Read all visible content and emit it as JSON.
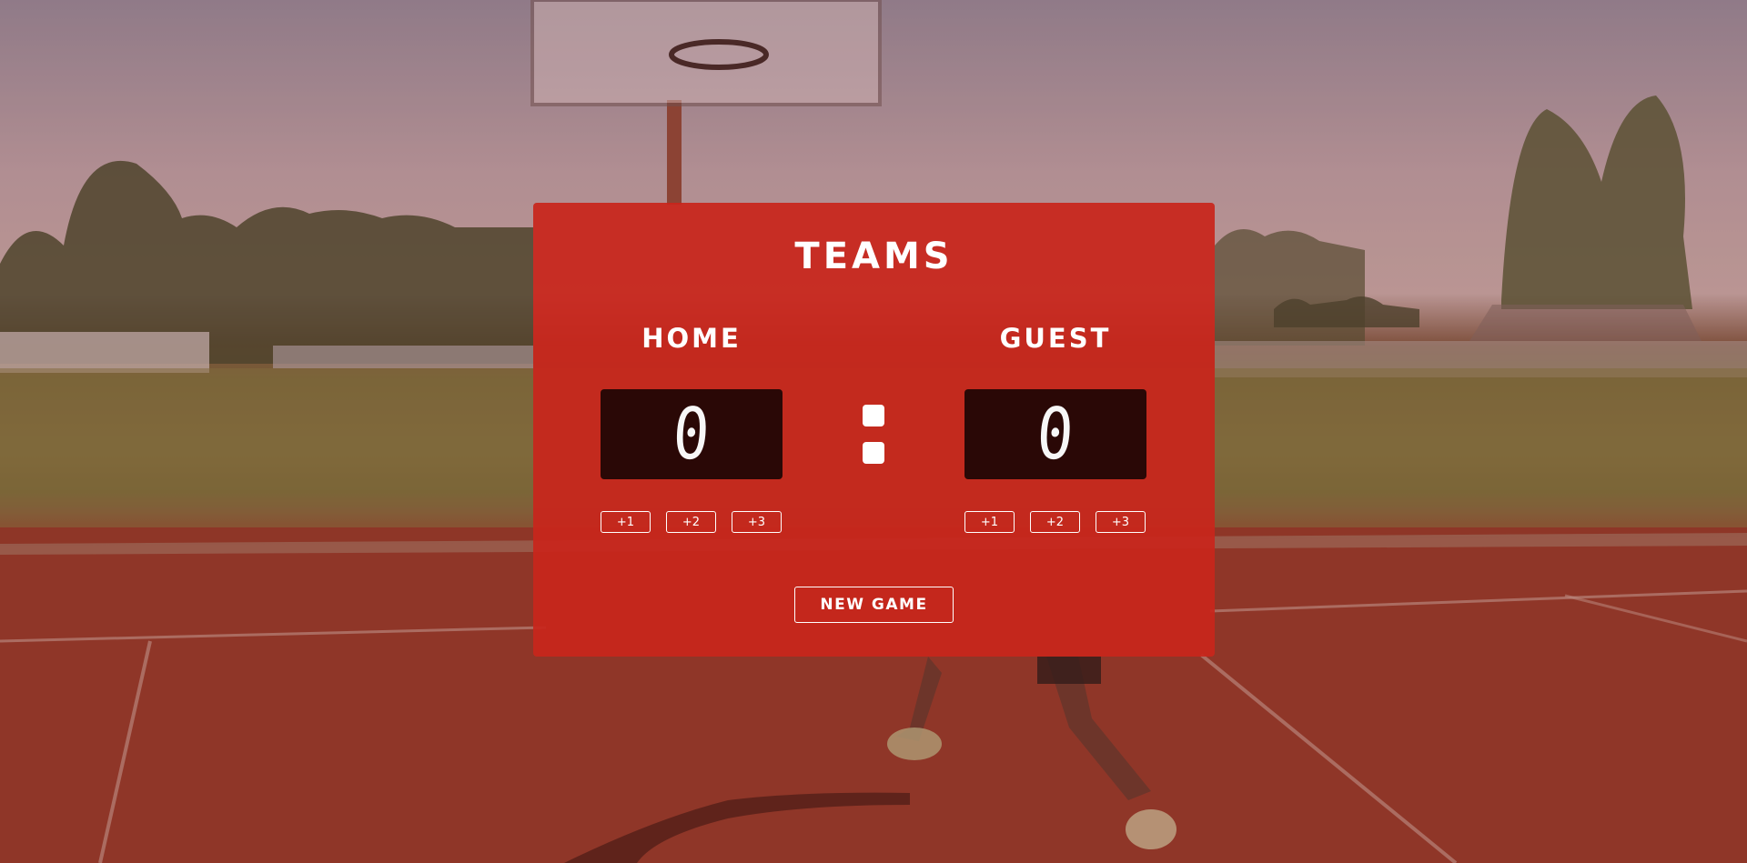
{
  "header": {
    "title": "TEAMS"
  },
  "teams": {
    "home": {
      "name": "HOME",
      "score": "0",
      "buttons": [
        "+1",
        "+2",
        "+3"
      ]
    },
    "guest": {
      "name": "GUEST",
      "score": "0",
      "buttons": [
        "+1",
        "+2",
        "+3"
      ]
    }
  },
  "actions": {
    "new_game": "NEW GAME"
  },
  "colors": {
    "card": "#c8261c",
    "score_bg": "#2a0806",
    "text": "#ffffff"
  },
  "background": {
    "scene": "basketball-court-photo"
  }
}
